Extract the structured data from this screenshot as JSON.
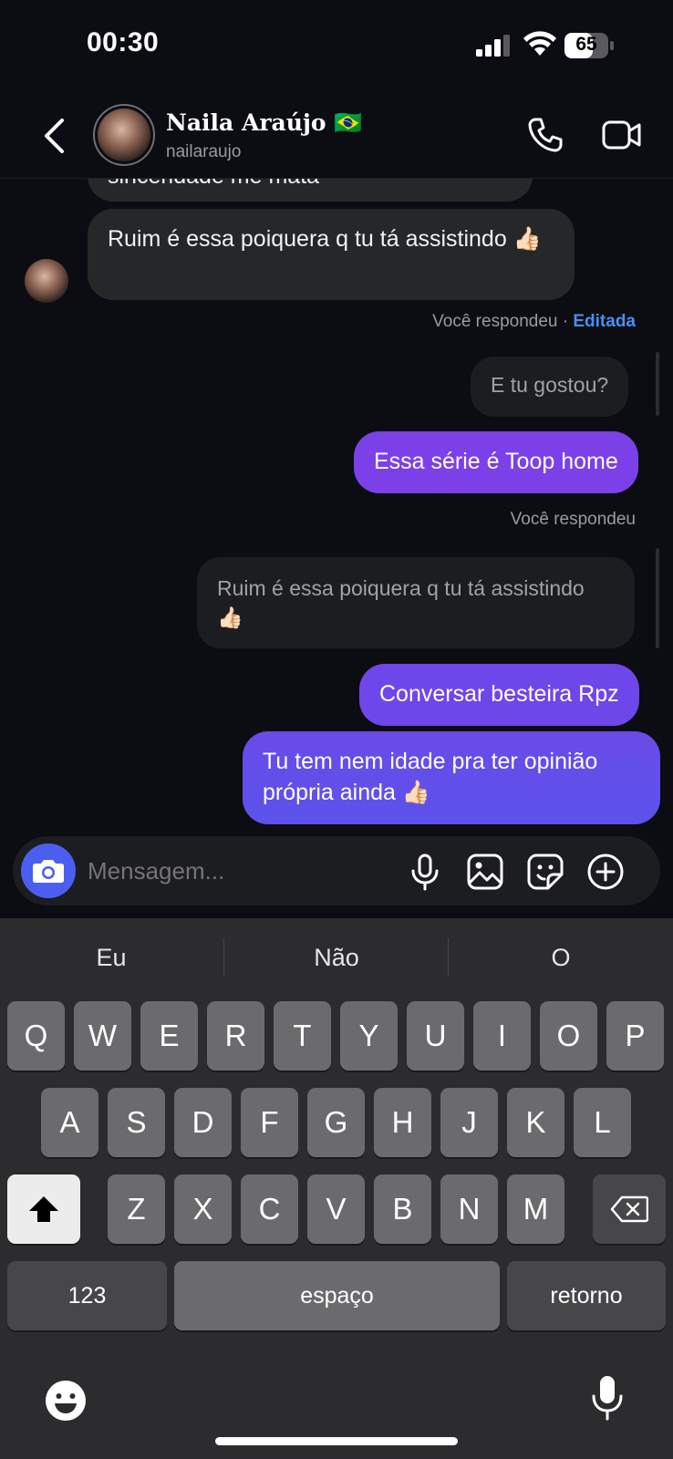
{
  "status": {
    "time": "00:30",
    "battery": "65"
  },
  "header": {
    "name": "Naila Araújo 🇧🇷",
    "handle": "nailaraujo"
  },
  "messages": {
    "cut_top": "sinceridade me mata",
    "incoming_1": "Ruim é essa poiquera q tu tá assistindo 👍🏻",
    "reply_meta_1": "Você respondeu",
    "edited_label": "Editada",
    "reply_quote_1": "E tu gostou?",
    "outgoing_1": "Essa série é Toop home",
    "reply_meta_2": "Você respondeu",
    "reply_quote_2": "Ruim é essa poiquera q tu tá assistindo 👍🏻",
    "outgoing_2": "Conversar besteira Rpz",
    "outgoing_3": "Tu tem nem idade pra ter opinião própria ainda 👍🏻"
  },
  "composer": {
    "placeholder": "Mensagem..."
  },
  "keyboard": {
    "suggestions": [
      "Eu",
      "Não",
      "O"
    ],
    "row1": [
      "Q",
      "W",
      "E",
      "R",
      "T",
      "Y",
      "U",
      "I",
      "O",
      "P"
    ],
    "row2": [
      "A",
      "S",
      "D",
      "F",
      "G",
      "H",
      "J",
      "K",
      "L"
    ],
    "row3": [
      "Z",
      "X",
      "C",
      "V",
      "B",
      "N",
      "M"
    ],
    "numbers_label": "123",
    "space_label": "espaço",
    "return_label": "retorno"
  },
  "colors": {
    "accent_purple": "#7b4de6",
    "accent_blue": "#4b5ef0",
    "edited_blue": "#4a8ef5"
  }
}
